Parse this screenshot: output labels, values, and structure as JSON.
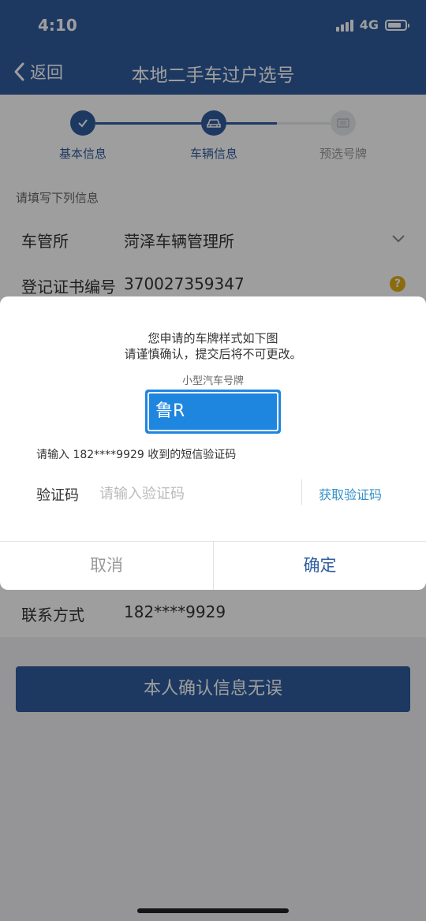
{
  "status_bar": {
    "time": "4:10",
    "network": "4G"
  },
  "nav": {
    "back_label": "返回",
    "title": "本地二手车过户选号"
  },
  "steps": [
    {
      "label": "基本信息",
      "state": "done"
    },
    {
      "label": "车辆信息",
      "state": "active"
    },
    {
      "label": "预选号牌",
      "state": "pending"
    }
  ],
  "form": {
    "hint": "请填写下列信息",
    "office_label": "车管所",
    "office_value": "菏泽车辆管理所",
    "cert_label": "登记证书编号",
    "cert_value": "370027359347",
    "contact_label": "联系方式",
    "contact_value": "182****9929"
  },
  "submit_label": "本人确认信息无误",
  "dialog": {
    "line1": "您申请的车牌样式如下图",
    "line2": "请谨慎确认，提交后将不可更改。",
    "plate_type": "小型汽车号牌",
    "plate_text": "鲁R",
    "sms_hint": "请输入 182****9929 收到的短信验证码",
    "code_label": "验证码",
    "code_placeholder": "请输入验证码",
    "get_code_label": "获取验证码",
    "cancel_label": "取消",
    "confirm_label": "确定"
  },
  "colors": {
    "primary": "#2f5d9e",
    "plate_blue": "#1f86e0",
    "link": "#3390c9",
    "step_pending": "#e6e8ec"
  },
  "icons": {
    "back": "chevron-left-icon",
    "step1": "check-icon",
    "step2": "car-icon",
    "step3": "plate-icon",
    "dropdown": "chevron-down-icon",
    "help": "question-icon"
  }
}
